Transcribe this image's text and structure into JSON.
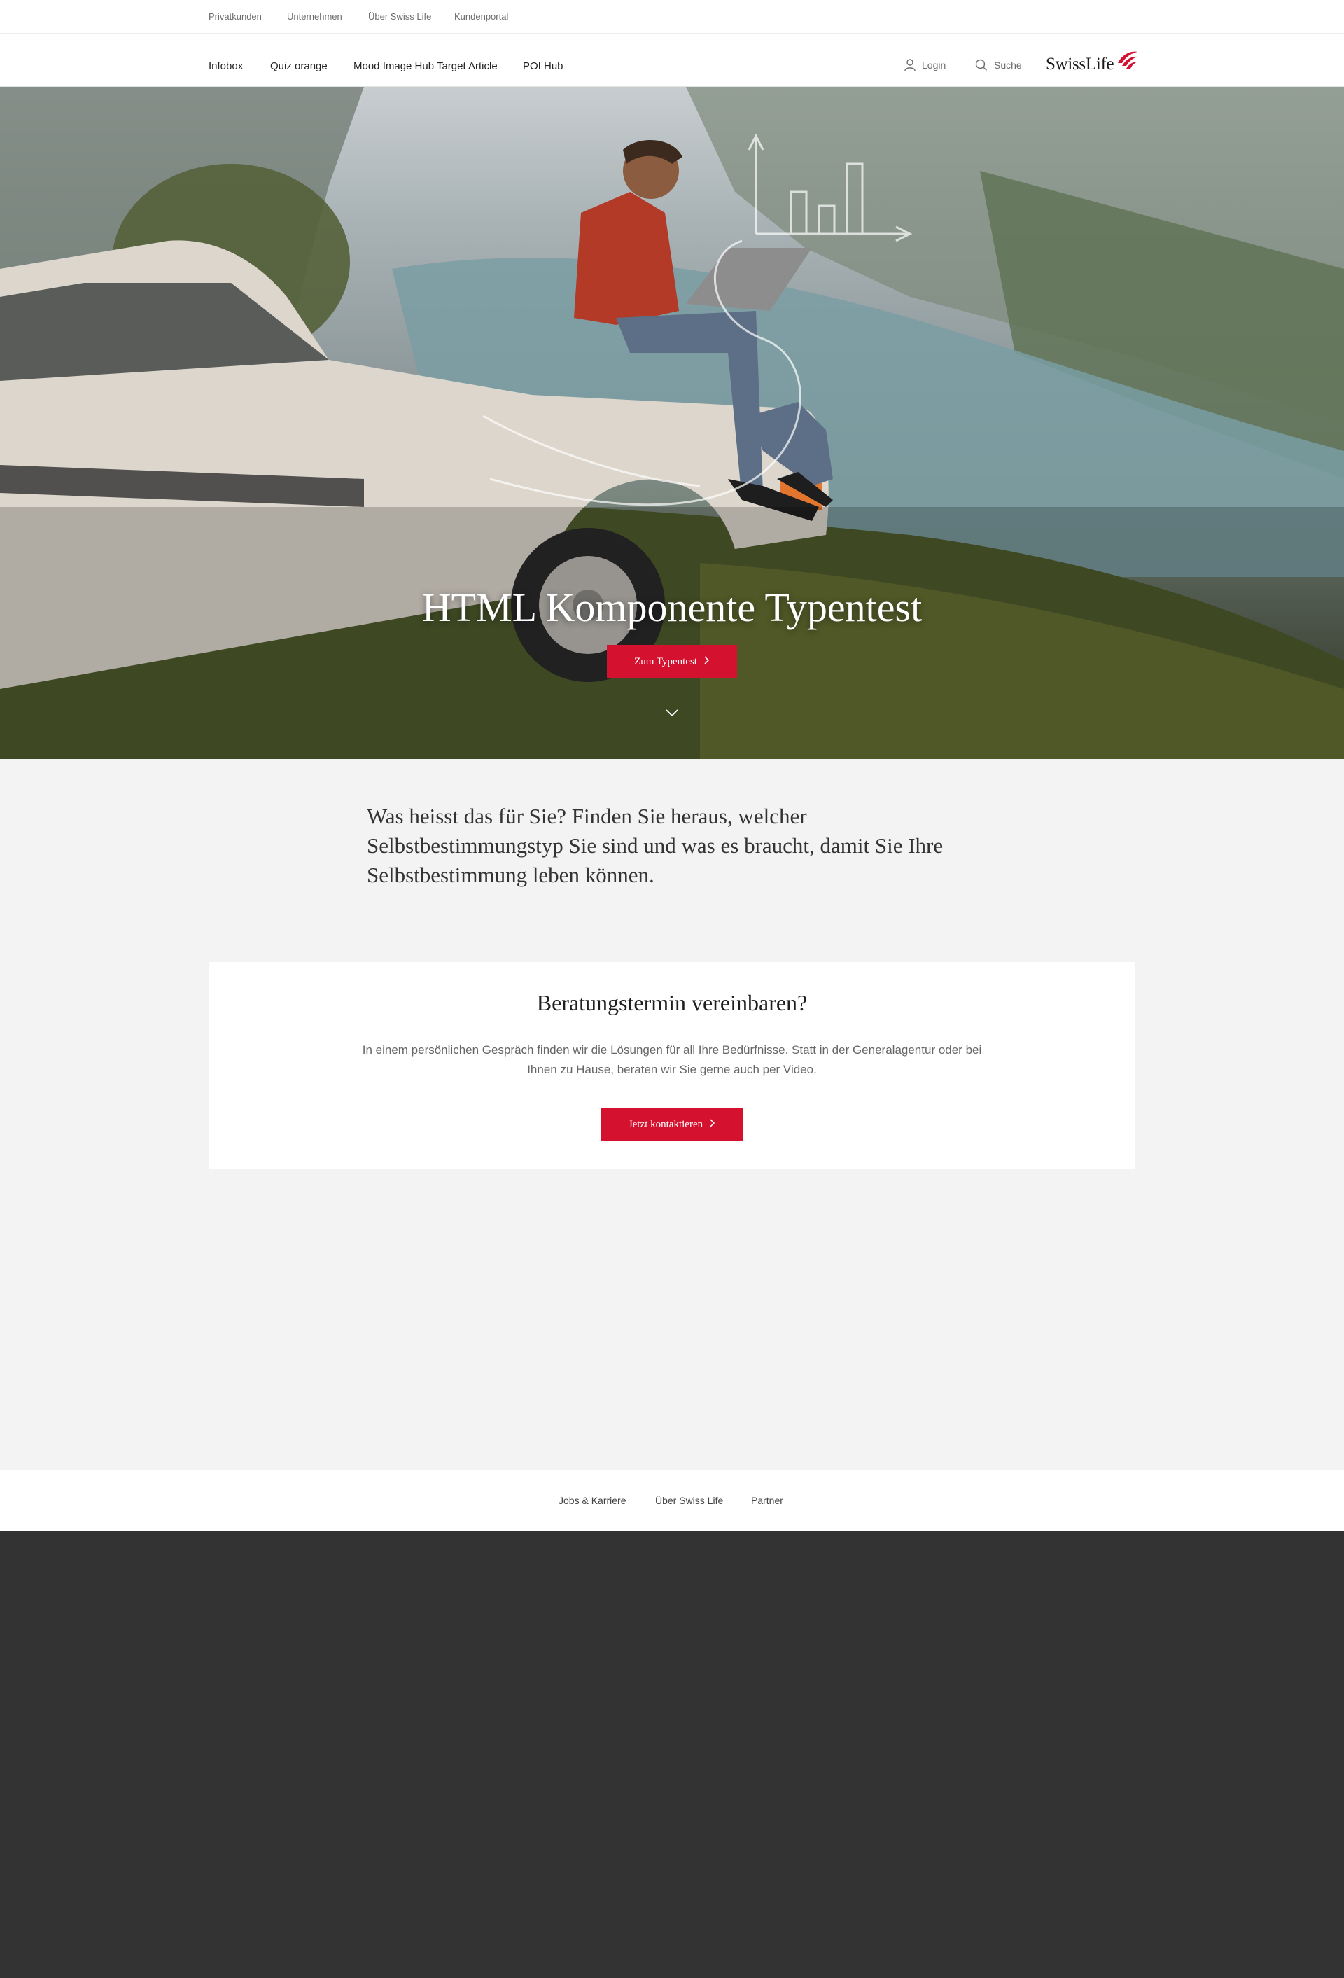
{
  "meta_nav": {
    "items": [
      {
        "label": "Privatkunden"
      },
      {
        "label": "Unternehmen"
      },
      {
        "label": "Über Swiss Life"
      },
      {
        "label": "Kundenportal"
      }
    ]
  },
  "main_nav": {
    "items": [
      {
        "label": "Infobox"
      },
      {
        "label": "Quiz orange"
      },
      {
        "label": "Mood Image Hub Target Article"
      },
      {
        "label": "POI Hub"
      }
    ],
    "login_label": "Login",
    "search_label": "Suche",
    "logo_text": "SwissLife"
  },
  "hero": {
    "title": "HTML Komponente Typentest",
    "cta_label": "Zum Typentest",
    "scroll_icon": "chevron-down-icon"
  },
  "intro": {
    "text": "Was heisst das für Sie? Finden Sie heraus, welcher Selbstbestimmungstyp Sie sind und was es braucht, damit Sie Ihre Selbstbestimmung leben können."
  },
  "consult": {
    "title": "Beratungstermin vereinbaren?",
    "text": "In einem persönlichen Gespräch finden wir die Lösungen für all Ihre Bedürfnisse. Statt in der Generalagentur oder bei Ihnen zu Hause, beraten wir Sie gerne auch per Video.",
    "cta_label": "Jetzt kontaktieren"
  },
  "footer": {
    "links": [
      {
        "label": "Jobs & Karriere"
      },
      {
        "label": "Über Swiss Life"
      },
      {
        "label": "Partner"
      }
    ]
  },
  "colors": {
    "accent": "#d4122f",
    "page_bg": "#f3f3f3",
    "footer_dark": "#333333"
  }
}
